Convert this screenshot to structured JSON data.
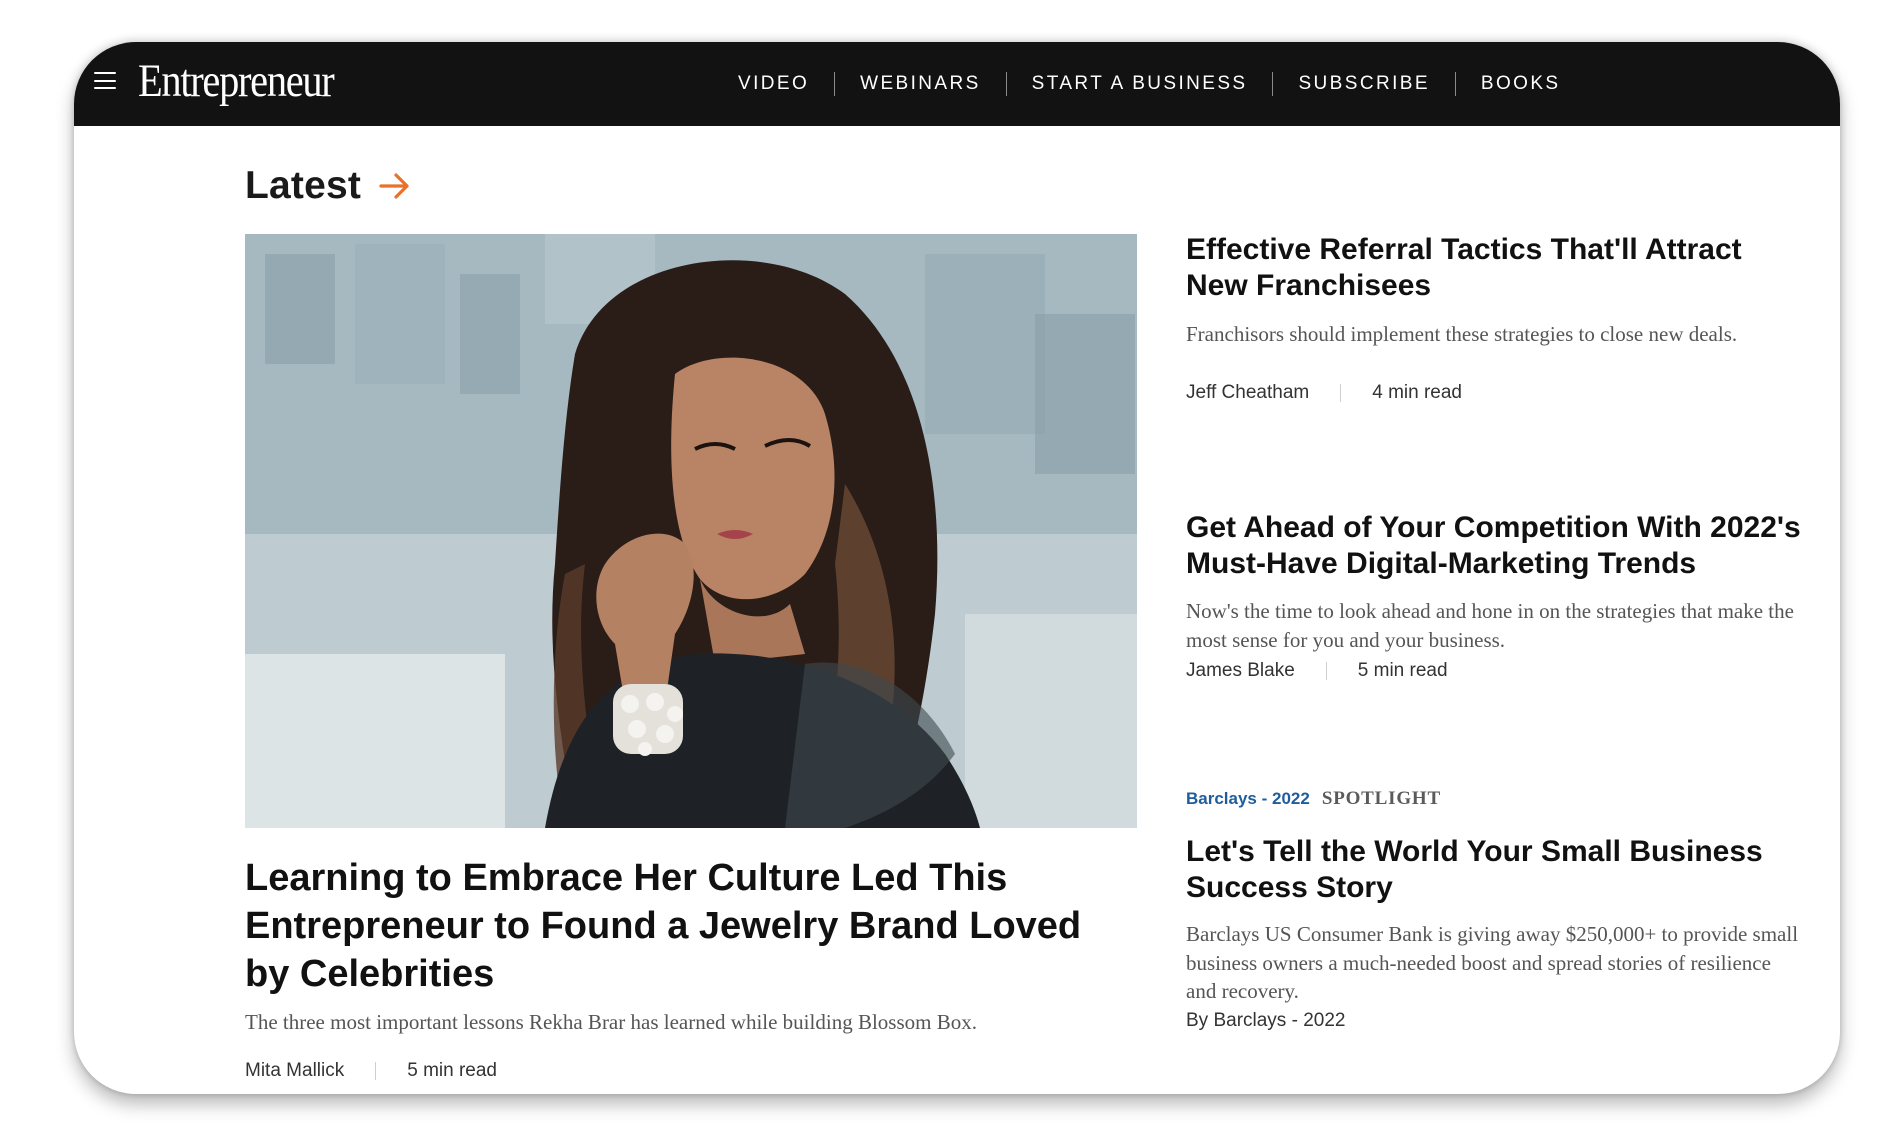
{
  "header": {
    "logo": "Entrepreneur",
    "menu_icon": "hamburger-menu-icon",
    "nav": [
      {
        "label": "VIDEO"
      },
      {
        "label": "WEBINARS"
      },
      {
        "label": "START A BUSINESS"
      },
      {
        "label": "SUBSCRIBE"
      },
      {
        "label": "BOOKS"
      }
    ]
  },
  "section": {
    "title": "Latest",
    "arrow_icon": "arrow-right-icon",
    "accent_color": "#e8722c"
  },
  "featured": {
    "title": "Learning to Embrace Her Culture Led This Entrepreneur to Found a Jewelry Brand Loved by Celebrities",
    "description": "The three most important lessons Rekha Brar has learned while building Blossom Box.",
    "author": "Mita Mallick",
    "read_time": "5 min read"
  },
  "articles": [
    {
      "title": "Effective Referral Tactics That'll Attract New Franchisees",
      "description": "Franchisors should implement these strategies to close new deals.",
      "author": "Jeff Cheatham",
      "read_time": "4 min read"
    },
    {
      "title": "Get Ahead of Your Competition With 2022's Must-Have Digital-Marketing Trends",
      "description": "Now's the time to look ahead and hone in on the strategies that make the most sense for you and your business.",
      "author": "James Blake",
      "read_time": "5 min read"
    },
    {
      "sponsor": "Barclays - 2022",
      "sponsor_label": "SPOTLIGHT",
      "title": "Let's Tell the World Your Small Business Success Story",
      "description": "Barclays US Consumer Bank is giving away $250,000+ to provide small business owners a much-needed boost and spread stories of resilience and recovery.",
      "byline": "By Barclays - 2022"
    }
  ],
  "colors": {
    "navbar_bg": "#121212",
    "sponsor_link": "#1f5d9c"
  }
}
